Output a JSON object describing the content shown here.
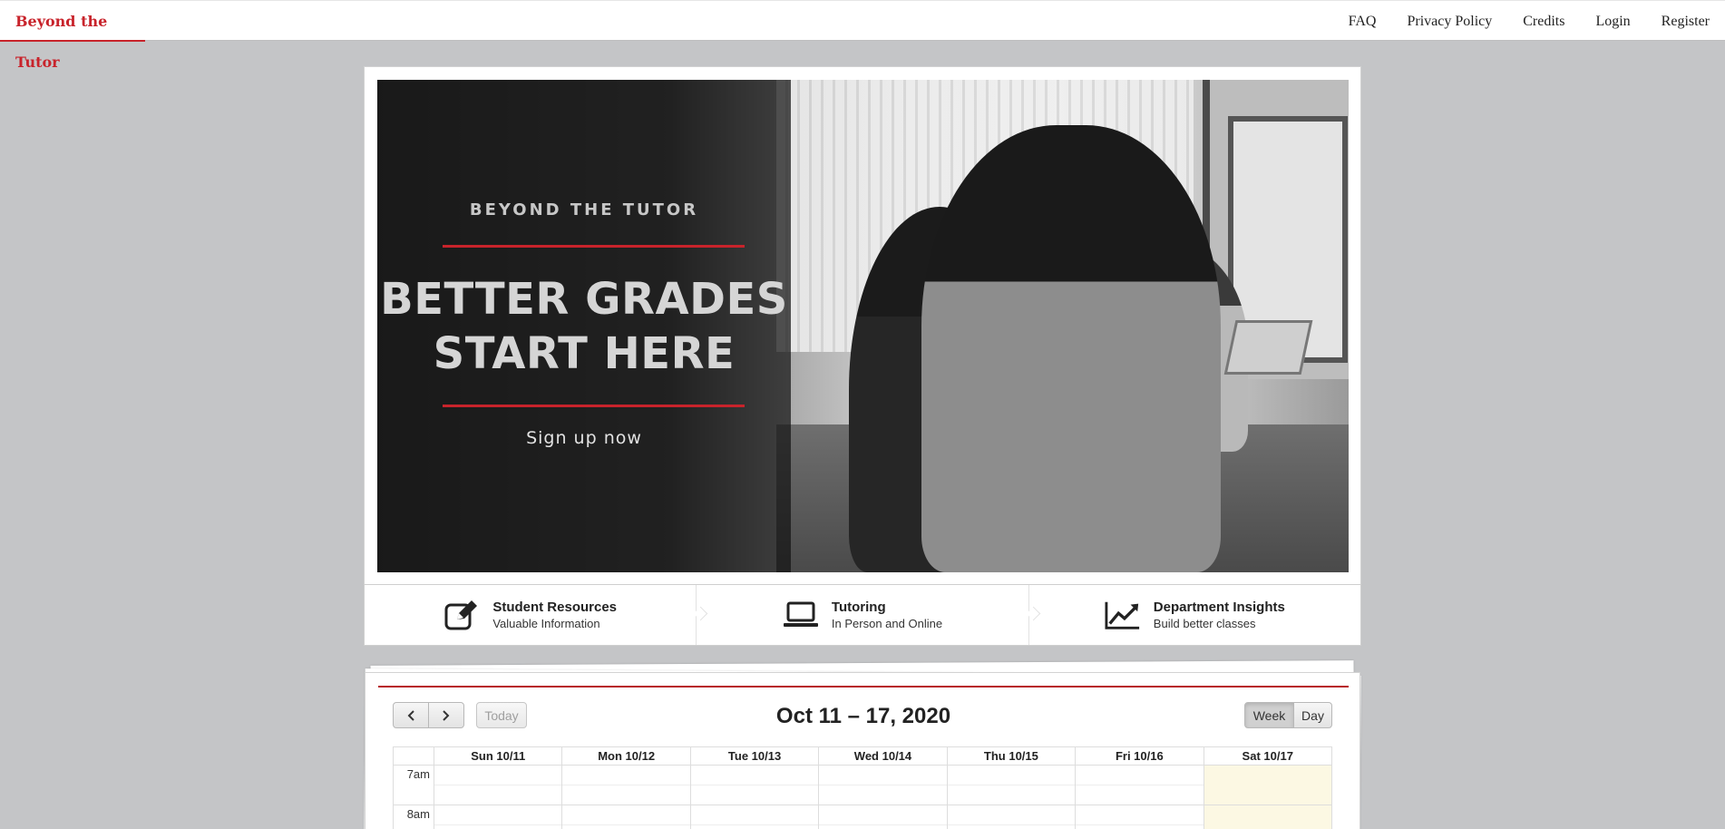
{
  "nav": {
    "brand": "Beyond the Tutor",
    "links": [
      "FAQ",
      "Privacy Policy",
      "Credits",
      "Login",
      "Register"
    ]
  },
  "hero": {
    "brand": "BEYOND THE TUTOR",
    "headline_line1": "BETTER GRADES",
    "headline_line2": "START HERE",
    "cta": "Sign up now"
  },
  "features": [
    {
      "icon": "edit-icon",
      "title": "Student Resources",
      "subtitle": "Valuable Information"
    },
    {
      "icon": "laptop-icon",
      "title": "Tutoring",
      "subtitle": "In Person and Online"
    },
    {
      "icon": "chart-line-icon",
      "title": "Department Insights",
      "subtitle": "Build better classes"
    }
  ],
  "calendar": {
    "prev_label": "<",
    "next_label": ">",
    "today_label": "Today",
    "title": "Oct 11 – 17, 2020",
    "week_label": "Week",
    "day_label": "Day",
    "days": [
      "Sun 10/11",
      "Mon 10/12",
      "Tue 10/13",
      "Wed 10/14",
      "Thu 10/15",
      "Fri 10/16",
      "Sat 10/17"
    ],
    "times": [
      "7am",
      "8am"
    ],
    "highlight_color": "#fcf8e3"
  },
  "colors": {
    "accent": "#c8232b",
    "background": "#c4c5c7"
  }
}
